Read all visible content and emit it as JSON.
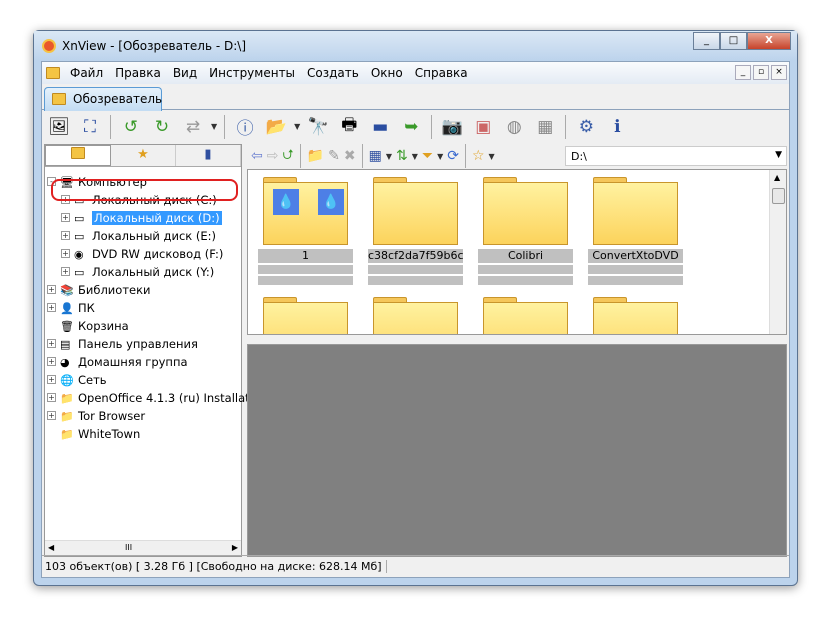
{
  "window": {
    "title": "XnView - [Обозреватель - D:\\]",
    "min": "_",
    "max": "□",
    "close": "X"
  },
  "menu": [
    "Файл",
    "Правка",
    "Вид",
    "Инструменты",
    "Создать",
    "Окно",
    "Справка"
  ],
  "mdi": [
    "_",
    "▫",
    "×"
  ],
  "tab": "Обозреватель",
  "left_tabs": [
    "folders",
    "favorites",
    "catalog"
  ],
  "tree": [
    {
      "label": "Компьютер",
      "icon": "computer-icon",
      "level": 0,
      "exp": "-"
    },
    {
      "label": "Локальный диск (C:)",
      "icon": "disk-icon",
      "level": 1,
      "exp": "+"
    },
    {
      "label": "Локальный диск (D:)",
      "icon": "disk-icon",
      "level": 1,
      "exp": "+",
      "selected": true
    },
    {
      "label": "Локальный диск (E:)",
      "icon": "disk-icon",
      "level": 1,
      "exp": "+"
    },
    {
      "label": "DVD RW дисковод (F:)",
      "icon": "dvd-icon",
      "level": 1,
      "exp": "+"
    },
    {
      "label": "Локальный диск (Y:)",
      "icon": "disk-icon",
      "level": 1,
      "exp": "+"
    },
    {
      "label": "Библиотеки",
      "icon": "library-icon",
      "level": 0,
      "exp": "+"
    },
    {
      "label": "ПК",
      "icon": "user-icon",
      "level": 0,
      "exp": "+"
    },
    {
      "label": "Корзина",
      "icon": "recycle-bin-icon",
      "level": 0,
      "exp": ""
    },
    {
      "label": "Панель управления",
      "icon": "control-panel-icon",
      "level": 0,
      "exp": "+"
    },
    {
      "label": "Домашняя группа",
      "icon": "homegroup-icon",
      "level": 0,
      "exp": "+"
    },
    {
      "label": "Сеть",
      "icon": "network-icon",
      "level": 0,
      "exp": "+"
    },
    {
      "label": "OpenOffice 4.1.3 (ru) Installatic",
      "icon": "folder-icon",
      "level": 0,
      "exp": "+"
    },
    {
      "label": "Tor Browser",
      "icon": "folder-icon",
      "level": 0,
      "exp": "+"
    },
    {
      "label": "WhiteTown",
      "icon": "folder-icon",
      "level": 0,
      "exp": ""
    }
  ],
  "address": "D:\\",
  "thumbs": [
    "1",
    "c38cf2da7f59b6c...",
    "Colibri",
    "ConvertXtoDVD",
    "",
    "",
    "",
    ""
  ],
  "status": {
    "count": "103 объект(ов) [ 3.28 Гб ]",
    "free": "[Свободно на диске: 628.14 Мб]"
  },
  "colors": {
    "selection": "#3399ff",
    "highlight_ring": "#e02020",
    "preview_bg": "#808080"
  }
}
